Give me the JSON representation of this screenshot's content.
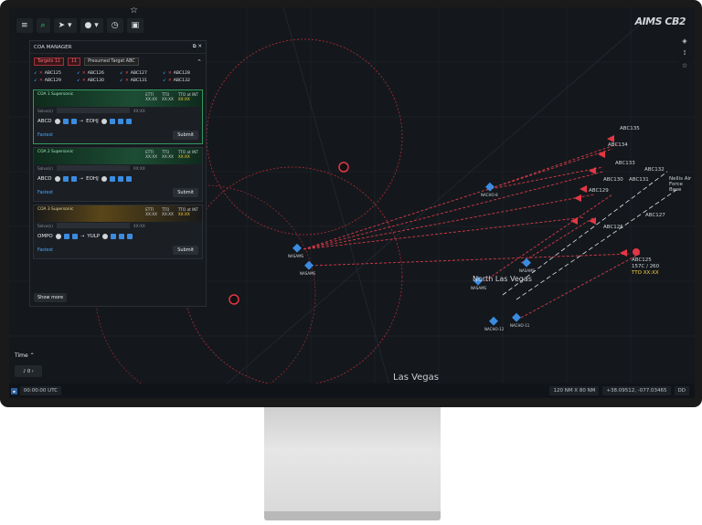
{
  "brand": "AIMS CB2",
  "toolbar": {
    "menu": "≡",
    "search": "⌕",
    "pointer": "➤ ▾",
    "pin": "● ▾",
    "timer": "◷",
    "layers": "▣"
  },
  "panel": {
    "title": "COA MANAGER",
    "filters": {
      "targets": "Targets 11",
      "count": "11",
      "select": "Presumed Target ABC"
    },
    "targets": [
      "ABC125",
      "ABC126",
      "ABC127",
      "ABC128",
      "ABC129",
      "ABC130",
      "ABC131",
      "ABC132"
    ],
    "coas": [
      {
        "name": "COA 1 Supersonic",
        "eta_lbl": "ETTI",
        "tto_lbl": "TTO",
        "eta": "XX:XX",
        "tto": "XX:XX",
        "tto_int_lbl": "TTO at INT",
        "tto_int": "XX:XX",
        "subrow_lbl": "Salvo(s)",
        "subrow_val": "XX:XX",
        "from": "ABCD",
        "to": "EOHJ",
        "fastest": "Fastest",
        "submit": "Submit"
      },
      {
        "name": "COA 2 Supersonic",
        "eta_lbl": "ETTI",
        "tto_lbl": "TTO",
        "eta": "XX:XX",
        "tto": "XX:XX",
        "tto_int_lbl": "TTO at INT",
        "tto_int": "XX:XX",
        "subrow_lbl": "Salvo(s)",
        "subrow_val": "XX:XX",
        "from": "ABCD",
        "to": "EOHJ",
        "fastest": "Fastest",
        "submit": "Submit"
      },
      {
        "name": "COA 3 Supersonic",
        "eta_lbl": "ETTI",
        "tto_lbl": "TTO",
        "eta": "XX:XX",
        "tto": "XX:XX",
        "tto_int_lbl": "TTO at INT",
        "tto_int": "XX:XX",
        "subrow_lbl": "Salvo(s)",
        "subrow_val": "XX:XX",
        "from": "OMPO",
        "to": "YULP",
        "fastest": "Fastest",
        "submit": "Submit"
      }
    ],
    "show_more": "Show more"
  },
  "time": {
    "label": "Time",
    "value": "0"
  },
  "status": {
    "utc": "00:00:00 UTC",
    "scale": "120 NM X 80 NM",
    "coords": "+38.09512, -077.03465",
    "dd": "DD"
  },
  "map": {
    "city": "Las Vegas",
    "north": "North Las Vegas",
    "nellis": "Nellis Air Force Base",
    "labels": [
      {
        "text": "ABC135"
      },
      {
        "text": "ABC134"
      },
      {
        "text": "ABC133"
      },
      {
        "text": "ABC132"
      },
      {
        "text": "ABC131"
      },
      {
        "text": "ABC130"
      },
      {
        "text": "ABC129"
      },
      {
        "text": "ABC127"
      },
      {
        "text": "ABC126"
      },
      {
        "text": "ABC125"
      }
    ],
    "speeds": "157C / 260",
    "tto": "TTO XX:XX",
    "bases": [
      "NACHO-8",
      "NASAMS",
      "NASAMS",
      "NASAMS",
      "NASAMS",
      "NACHO-12",
      "NACHO-11"
    ]
  }
}
